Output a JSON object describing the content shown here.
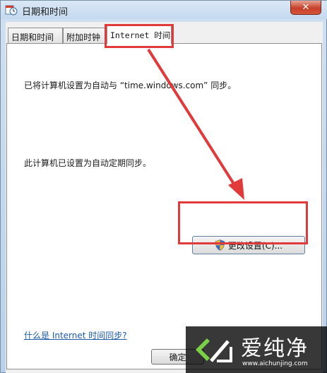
{
  "window": {
    "title": "日期和时间",
    "close_label": "✕"
  },
  "tabs": [
    {
      "label": "日期和时间",
      "active": false
    },
    {
      "label": "附加时钟",
      "active": false
    },
    {
      "label": "Internet 时间",
      "active": true
    }
  ],
  "panel": {
    "sync_message": "已将计算机设置为自动与 “time.windows.com” 同步。",
    "schedule_message": "此计算机已设置为自动定期同步。",
    "change_settings_label": "更改设置(C)...",
    "help_link": "什么是 Internet 时间同步?"
  },
  "footer": {
    "ok_label": "确定"
  },
  "watermark": {
    "brand": "爱纯净",
    "url": "www.aichunjing.com"
  },
  "colors": {
    "annotation": "#e03a3a",
    "link": "#1c5aa8"
  }
}
